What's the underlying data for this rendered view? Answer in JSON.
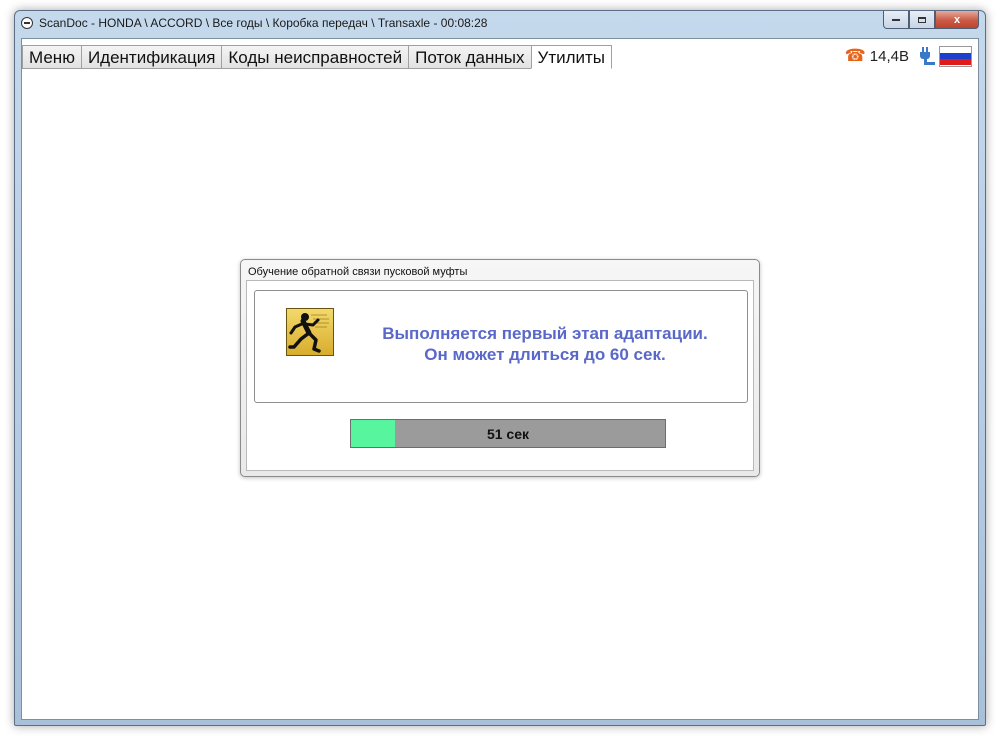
{
  "window": {
    "title": "ScanDoc - HONDA \\ ACCORD \\ Все годы \\ Коробка передач \\ Transaxle - 00:08:28",
    "controls": {
      "minimize": "minimize",
      "maximize": "maximize",
      "close": "x"
    }
  },
  "tabs": [
    {
      "label": "Меню"
    },
    {
      "label": "Идентификация"
    },
    {
      "label": "Коды неисправностей"
    },
    {
      "label": "Поток данных"
    },
    {
      "label": "Утилиты",
      "active": true
    }
  ],
  "status": {
    "voltage": "14,4В",
    "icons": [
      "phone-icon",
      "plug-icon",
      "russian-flag-icon"
    ],
    "phone_color": "#e8631a"
  },
  "dialog": {
    "title": "Обучение обратной связи пусковой муфты",
    "message_line1": "Выполняется первый этап адаптации.",
    "message_line2": "Он может длиться до 60 сек.",
    "message_color": "#5a68c9",
    "icon": "running-man-icon",
    "progress": {
      "fraction": 0.14,
      "label": "51 сек",
      "fill_color": "#57f59d",
      "track_color": "#9b9b9b"
    }
  }
}
